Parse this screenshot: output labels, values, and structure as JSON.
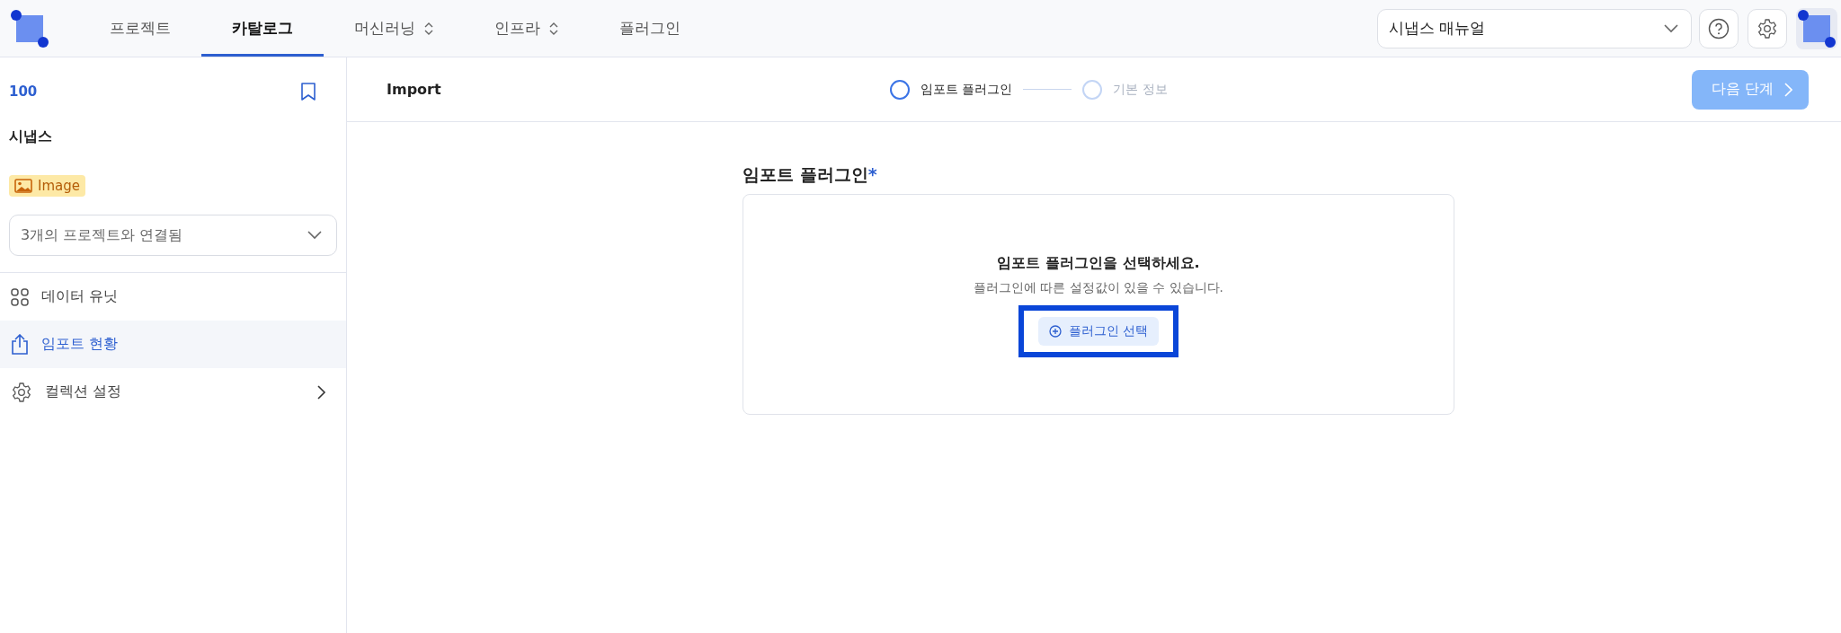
{
  "header": {
    "tabs": [
      {
        "label": "프로젝트",
        "selected": false,
        "dropdown": false
      },
      {
        "label": "카탈로그",
        "selected": true,
        "dropdown": false
      },
      {
        "label": "머신러닝",
        "selected": false,
        "dropdown": true
      },
      {
        "label": "인프라",
        "selected": false,
        "dropdown": true
      },
      {
        "label": "플러그인",
        "selected": false,
        "dropdown": false
      }
    ],
    "workspace_select": {
      "value": "시냅스 매뉴얼"
    }
  },
  "sidebar": {
    "id_label": "100",
    "title": "시냅스",
    "type_badge": "Image",
    "projects_select": {
      "value": "3개의 프로젝트와 연결됨"
    },
    "items": [
      {
        "label": "데이터 유닛",
        "selected": false,
        "has_submenu": false
      },
      {
        "label": "임포트 현황",
        "selected": true,
        "has_submenu": false
      },
      {
        "label": "컬렉션 설정",
        "selected": false,
        "has_submenu": true
      }
    ]
  },
  "toolbar": {
    "title": "Import",
    "steps": [
      {
        "label": "임포트 플러그인",
        "active": true
      },
      {
        "label": "기본 정보",
        "active": false
      }
    ],
    "next_button": {
      "label": "다음 단계",
      "disabled": true
    }
  },
  "plugin_section": {
    "title": "임포트 플러그인",
    "required_mark": "*",
    "heading": "임포트 플러그인을 선택하세요.",
    "description": "플러그인에 따른 설정값이 있을 수 있습니다.",
    "select_button": {
      "label": "플러그인 선택",
      "highlighted": true
    }
  }
}
